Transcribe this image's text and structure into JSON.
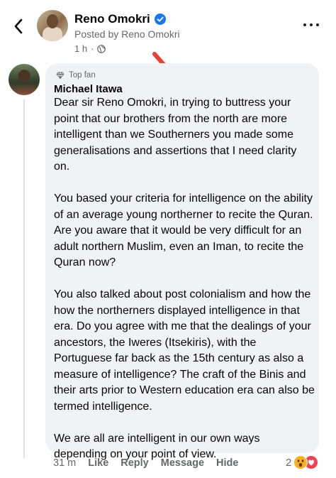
{
  "post": {
    "author": "Reno Omokri",
    "posted_by": "Posted by Reno Omokri",
    "age": "1 h",
    "separator": "·"
  },
  "comment": {
    "badge": "Top fan",
    "author": "Michael Itawa",
    "paragraphs": [
      "Dear sir Reno Omokri, in trying to buttress your point that our brothers from the north are more intelligent than we Southerners  you made some generalisations and assertions that I need clarity on.",
      "You based your criteria for intelligence on the ability of an average young northerner to recite the Quran. Are you aware that it would be very difficult for an adult northern Muslim, even an Iman, to recite the Quran now?",
      "You also talked about post colonialism and how the how the northerners displayed intelligence in that era. Do you agree with me that the dealings of your ancestors, the Iweres (Itsekiris), with the Portuguese far back as the 15th century as also a measure of intelligence? The craft of the Binis and their arts prior to Western education era can also be termed intelligence.",
      "We are all are intelligent in our own ways depending on your point of view."
    ],
    "time": "31 m",
    "actions": [
      "Like",
      "Reply",
      "Message",
      "Hide"
    ],
    "reaction_count": "2",
    "reaction_icons": [
      "wow-icon",
      "love-icon"
    ]
  },
  "colors": {
    "verified": "#1877f2",
    "arrow": "#e8432f",
    "bubble": "#f0f2f5",
    "secondary_text": "#65676b"
  }
}
